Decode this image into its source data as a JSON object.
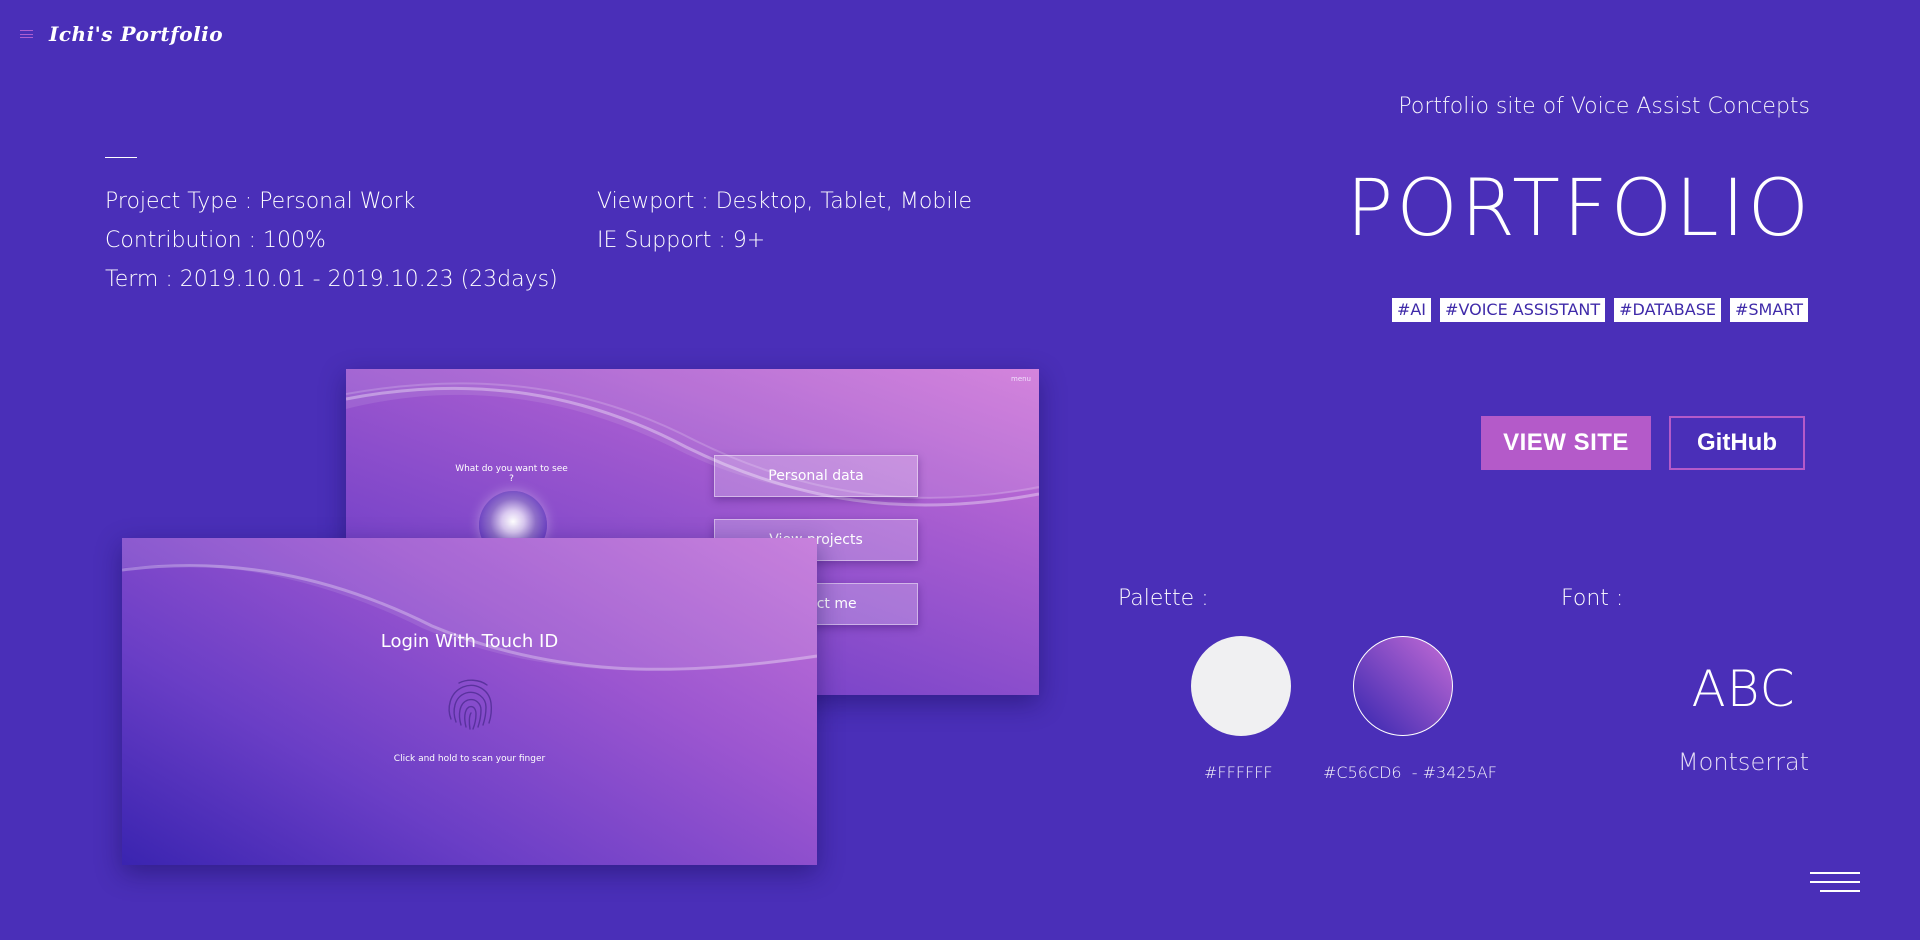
{
  "brand": {
    "title": "Ichi's Portfolio"
  },
  "info": {
    "project_type": "Project Type : Personal Work",
    "contribution": "Contribution : 100%",
    "term": "Term : 2019.10.01 - 2019.10.23 (23days)",
    "viewport": "Viewport : Desktop, Tablet, Mobile",
    "ie_support": "IE Support : 9+"
  },
  "header": {
    "subtitle": "Portfolio site of Voice Assist Concepts",
    "title": "PORTFOLIO",
    "tags": [
      "#AI",
      "#VOICE ASSISTANT",
      "#DATABASE",
      "#SMART"
    ]
  },
  "actions": {
    "view_site": "VIEW SITE",
    "github": "GitHub"
  },
  "palette": {
    "label": "Palette :",
    "swatches": [
      {
        "label": "#FFFFFF",
        "color": "#FFFFFF"
      },
      {
        "label": "#C56CD6  - #3425AF",
        "color_start": "#C56CD6",
        "color_end": "#3425AF"
      }
    ]
  },
  "font": {
    "label": "Font :",
    "sample": "ABC",
    "name": "Montserrat"
  },
  "mockup_back": {
    "menu": "menu",
    "question": "What do you want to see ?",
    "buttons": [
      "Personal data",
      "View projects",
      "Contact me"
    ]
  },
  "mockup_front": {
    "title": "Login With Touch ID",
    "hint": "Click and hold to scan your finger"
  },
  "colors": {
    "background": "#4a2fb8",
    "accent": "#b45ac9",
    "tag_text": "#3f2aa9"
  },
  "icons": {
    "top_menu": "hamburger-icon",
    "bottom_menu": "hamburger-icon",
    "fingerprint": "fingerprint-icon"
  }
}
